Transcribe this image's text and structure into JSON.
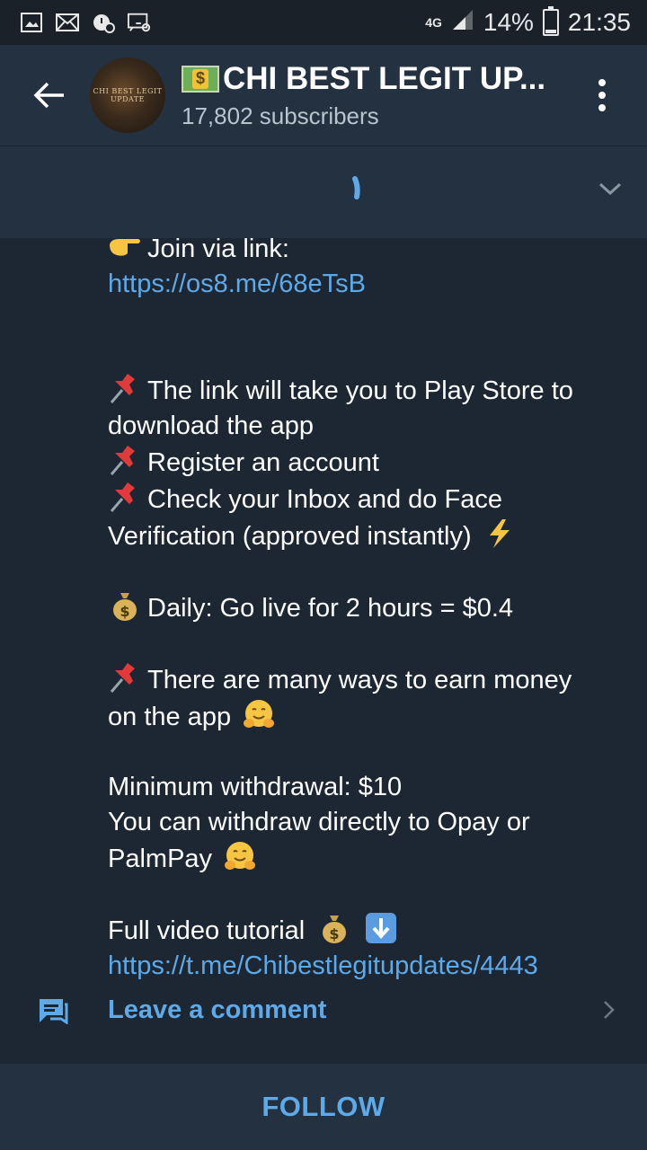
{
  "status_bar": {
    "network": "4G",
    "battery": "14%",
    "battery_level": 0.14,
    "time": "21:35",
    "icons": [
      "image-icon",
      "mail-icon",
      "notification-icon",
      "cast-icon"
    ]
  },
  "header": {
    "back_icon": "arrow-left-icon",
    "avatar_text": "CHI BEST LEGIT UPDATE",
    "title_emoji": "money-bill-emoji",
    "title": "CHI BEST LEGIT UP...",
    "subscribers": "17,802 subscribers",
    "menu_icon": "more-vertical-icon"
  },
  "pinbar": {
    "chevron_icon": "chevron-down-icon"
  },
  "message": {
    "join_line": "Join via link:",
    "join_link": "https://os8.me/68eTsB",
    "step1a": "The link will take you to Play Store to",
    "step1b": "download the app",
    "step2": "Register an account",
    "step3a": "Check your Inbox and do Face",
    "step3b": "Verification (approved instantly)",
    "daily": "Daily: Go live for 2 hours = $0.4",
    "ways_a": "There are many ways to earn money",
    "ways_b": "on the app",
    "min_withdrawal": "Minimum withdrawal: $10",
    "withdraw_a": "You can withdraw  directly to Opay or",
    "withdraw_b": "PalmPay",
    "tutorial": "Full video tutorial",
    "tutorial_link": "https://t.me/Chibestlegitupdates/4443"
  },
  "comment": {
    "label": "Leave a comment"
  },
  "follow": {
    "label": "FOLLOW"
  }
}
